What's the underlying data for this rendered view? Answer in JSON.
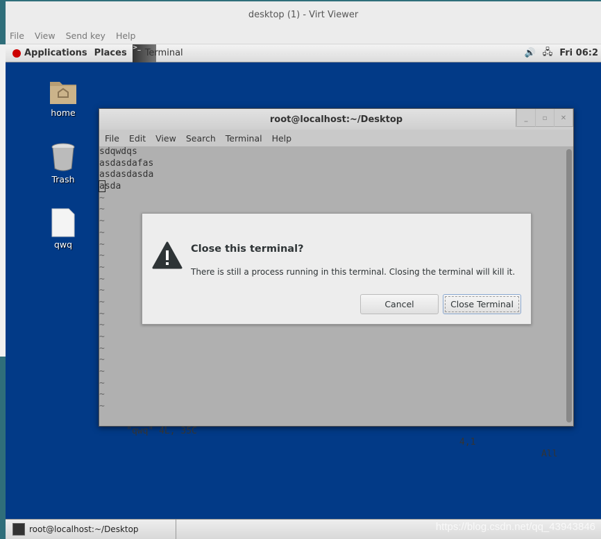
{
  "viewer": {
    "title": "desktop (1) - Virt Viewer",
    "menu": [
      "File",
      "View",
      "Send key",
      "Help"
    ]
  },
  "top_panel": {
    "applications": "Applications",
    "places": "Places",
    "task": "Terminal",
    "clock": "Fri 06:2"
  },
  "desktop_icons": [
    {
      "label": "home",
      "icon": "home-folder-icon"
    },
    {
      "label": "Trash",
      "icon": "trash-icon"
    },
    {
      "label": "qwq",
      "icon": "file-icon"
    }
  ],
  "terminal": {
    "title": "root@localhost:~/Desktop",
    "menu": [
      "File",
      "Edit",
      "View",
      "Search",
      "Terminal",
      "Help"
    ],
    "lines": [
      "sdqwdqs",
      "asdasdafas",
      "asdasdasda",
      "asda"
    ],
    "status_left": "\"qwq\" 4L, 35C",
    "status_pos": "4,1",
    "status_right": "All"
  },
  "dialog": {
    "heading": "Close this terminal?",
    "message": "There is still a process running in this terminal. Closing the terminal will kill it.",
    "cancel": "Cancel",
    "confirm": "Close Terminal"
  },
  "bottom_panel": {
    "task": "root@localhost:~/Desktop",
    "watermark": "https://blog.csdn.net/qq_43943846"
  }
}
